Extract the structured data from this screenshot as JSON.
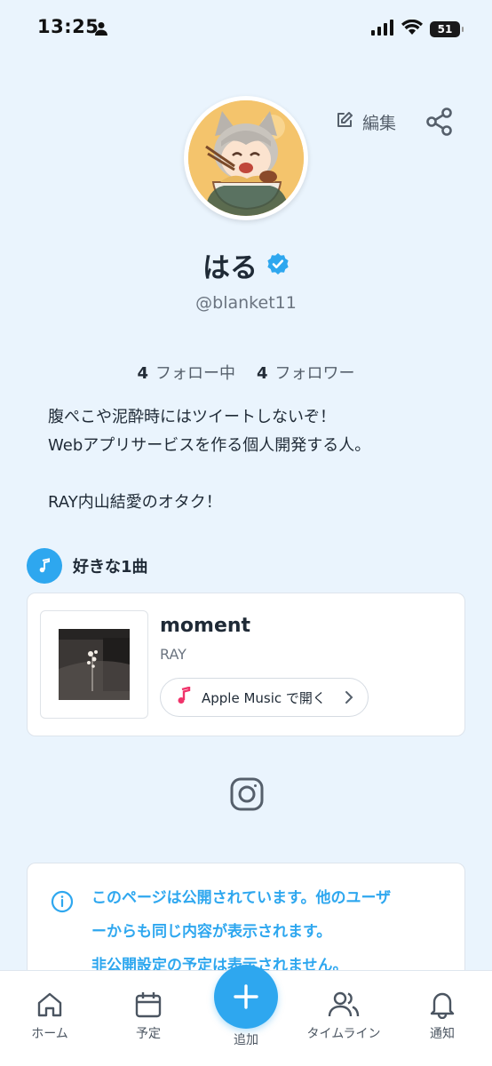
{
  "status_bar": {
    "time": "13:25",
    "battery": "51"
  },
  "header": {
    "edit_label": "編集"
  },
  "profile": {
    "name": "はる",
    "handle": "@blanket11",
    "following_count": "4",
    "following_label": "フォロー中",
    "followers_count": "4",
    "followers_label": "フォロワー",
    "bio": [
      "腹ぺこや泥酔時にはツイートしないぞ！",
      "Webアプリサービスを作る個人開発する人。",
      "",
      "RAY内山結愛のオタク！"
    ]
  },
  "favorite_song": {
    "section_title": "好きな1曲",
    "title": "moment",
    "artist": "RAY",
    "open_button": "Apple Music で開く"
  },
  "notice": {
    "lines": [
      "このページは公開されています。他のユーザ",
      "ーからも同じ内容が表示されます。",
      "非公開設定の予定は表示されません。"
    ]
  },
  "bottom_nav": {
    "home": "ホーム",
    "schedule": "予定",
    "add": "追加",
    "timeline": "タイムライン",
    "notifications": "通知"
  },
  "colors": {
    "accent": "#2ea7ef",
    "background": "#eaf4fd",
    "music_icon": "#f0336a"
  }
}
